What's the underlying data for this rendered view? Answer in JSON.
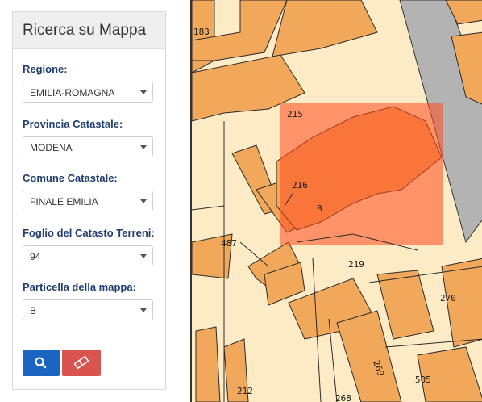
{
  "panel": {
    "title": "Ricerca su Mappa",
    "fields": [
      {
        "label": "Regione:",
        "value": "EMILIA-ROMAGNA"
      },
      {
        "label": "Provincia Catastale:",
        "value": "MODENA"
      },
      {
        "label": "Comune Catastale:",
        "value": "FINALE EMILIA"
      },
      {
        "label": "Foglio del Catasto Terreni:",
        "value": "94"
      },
      {
        "label": "Particella della mappa:",
        "value": "B"
      }
    ],
    "search_icon": "search-icon",
    "clear_icon": "eraser-icon"
  },
  "map": {
    "parcel_labels": [
      "183",
      "215",
      "216",
      "B",
      "487",
      "219",
      "270",
      "269",
      "505",
      "212",
      "268"
    ],
    "colors": {
      "building": "#f2a85a",
      "land": "#fdebc6",
      "road": "#b3b3b3",
      "highlight": "#ff4b1f",
      "line": "#2b2b2b"
    }
  }
}
